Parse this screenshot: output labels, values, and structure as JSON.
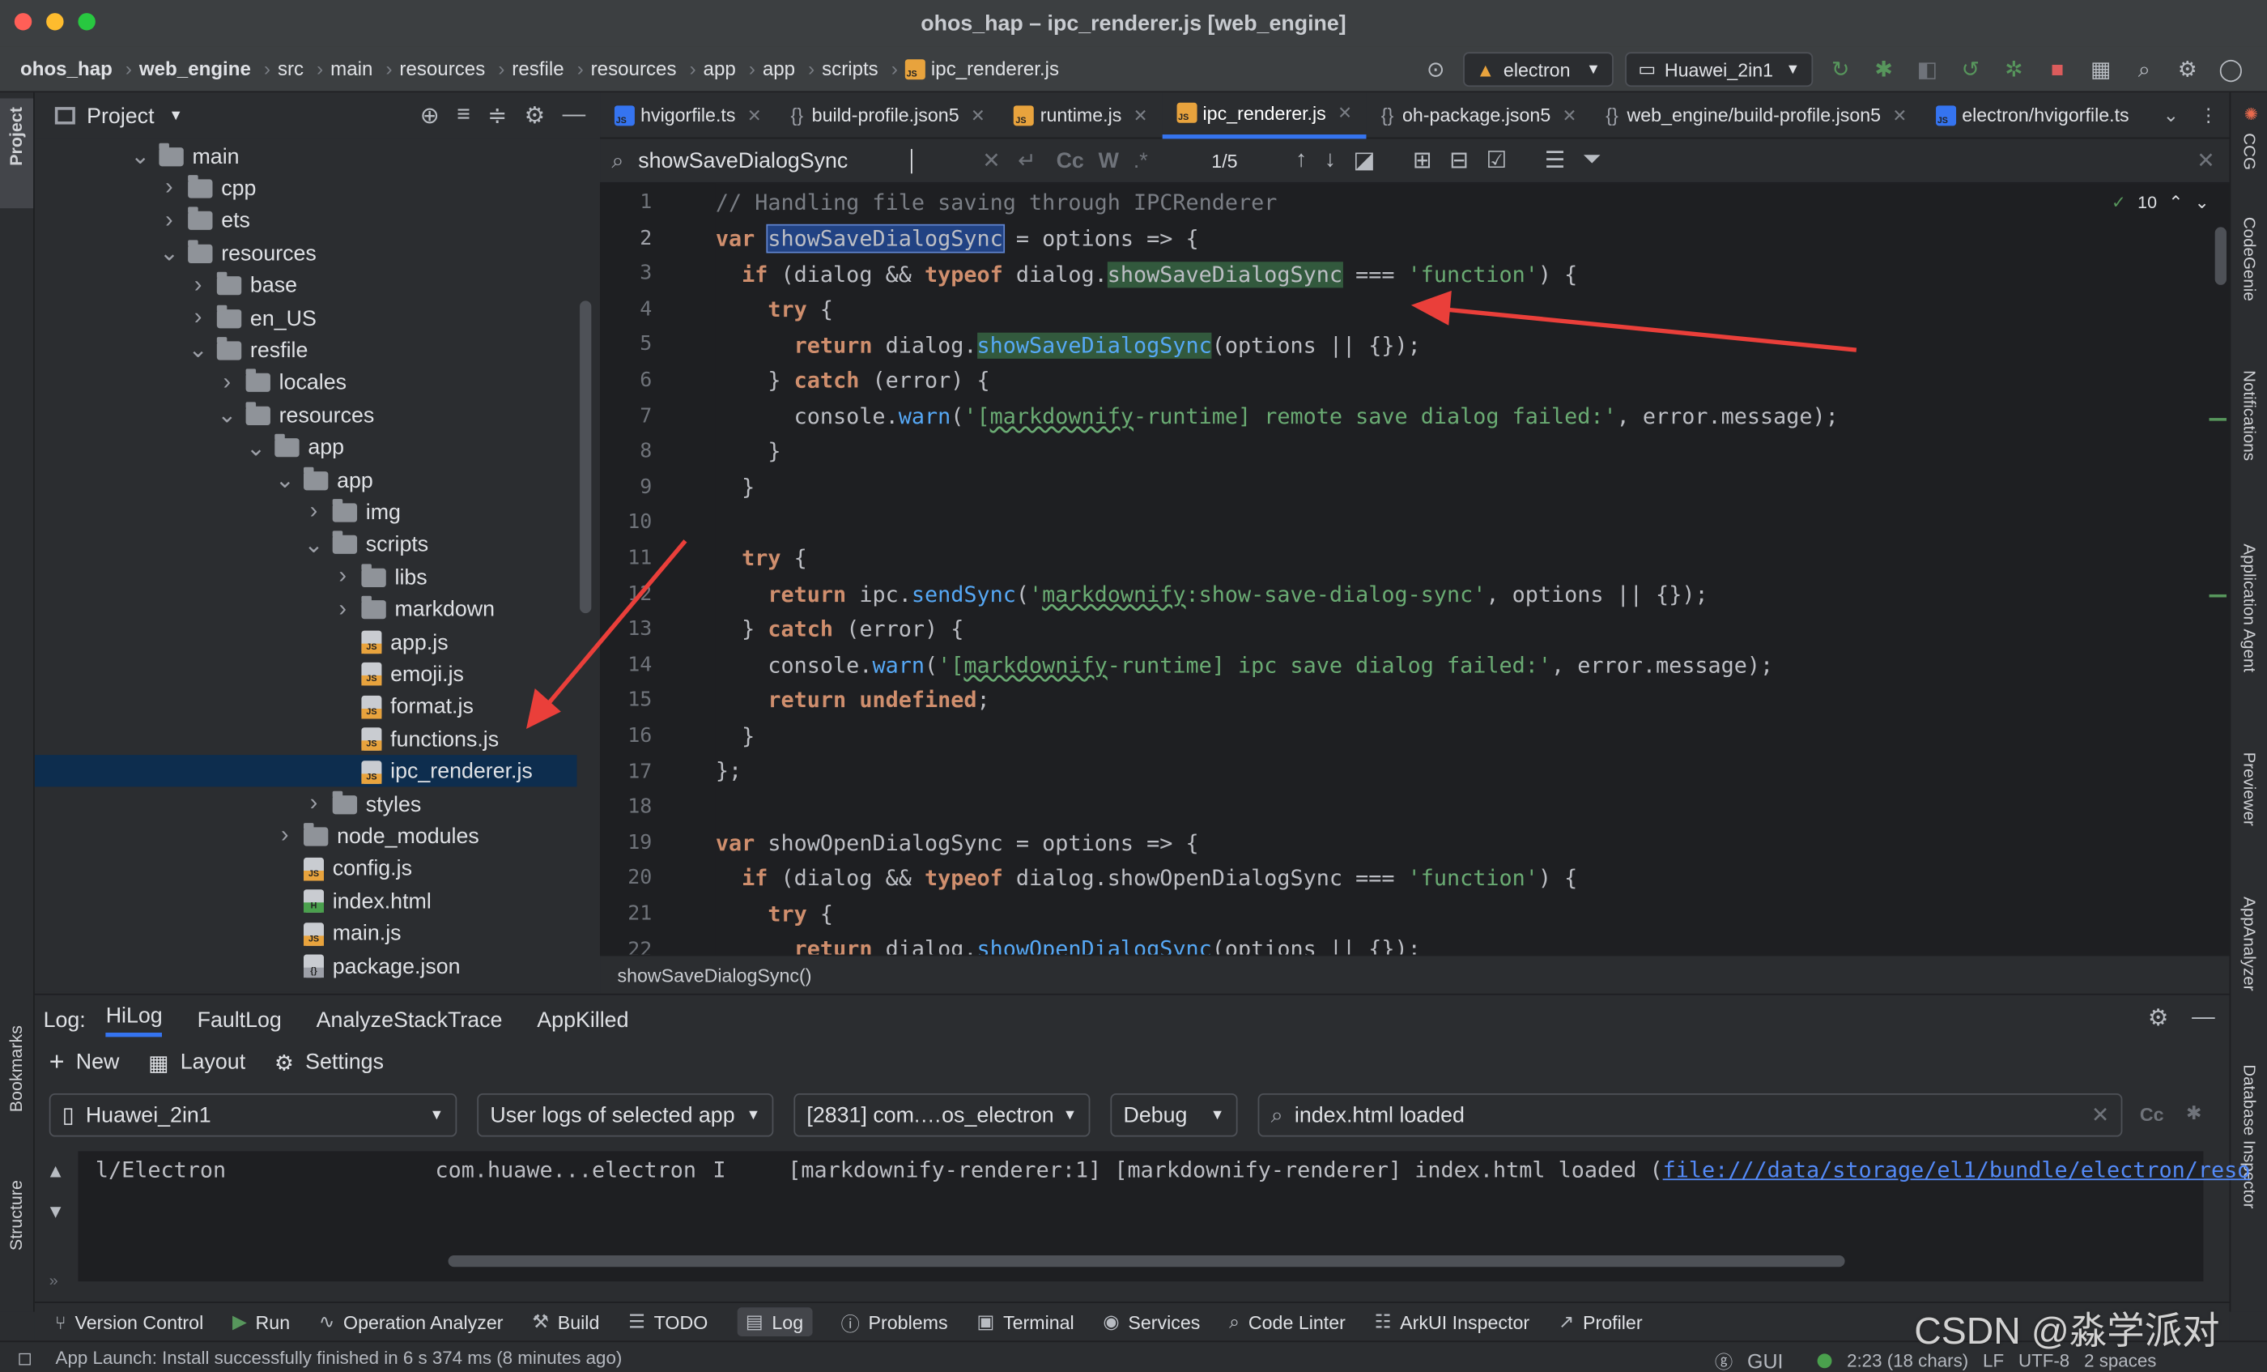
{
  "window": {
    "title": "ohos_hap – ipc_renderer.js [web_engine]"
  },
  "navbar": {
    "crumbs": [
      "ohos_hap",
      "web_engine",
      "src",
      "main",
      "resources",
      "resfile",
      "resources",
      "app",
      "app",
      "scripts",
      "ipc_renderer.js"
    ],
    "run_config": "electron",
    "device": "Huawei_2in1"
  },
  "project_panel": {
    "title": "Project",
    "tree": [
      {
        "label": "main",
        "type": "folder",
        "open": true
      },
      {
        "label": "cpp",
        "type": "folder"
      },
      {
        "label": "ets",
        "type": "folder"
      },
      {
        "label": "resources",
        "type": "folder",
        "open": true
      },
      {
        "label": "base",
        "type": "folder"
      },
      {
        "label": "en_US",
        "type": "folder"
      },
      {
        "label": "resfile",
        "type": "folder",
        "open": true
      },
      {
        "label": "locales",
        "type": "folder"
      },
      {
        "label": "resources",
        "type": "folder",
        "open": true
      },
      {
        "label": "app",
        "type": "folder",
        "open": true
      },
      {
        "label": "app",
        "type": "folder",
        "open": true
      },
      {
        "label": "img",
        "type": "folder"
      },
      {
        "label": "scripts",
        "type": "folder",
        "open": true
      },
      {
        "label": "libs",
        "type": "folder"
      },
      {
        "label": "markdown",
        "type": "folder"
      },
      {
        "label": "app.js",
        "type": "js"
      },
      {
        "label": "emoji.js",
        "type": "js"
      },
      {
        "label": "format.js",
        "type": "js"
      },
      {
        "label": "functions.js",
        "type": "js"
      },
      {
        "label": "ipc_renderer.js",
        "type": "js",
        "selected": true
      },
      {
        "label": "styles",
        "type": "folder"
      },
      {
        "label": "node_modules",
        "type": "folder"
      },
      {
        "label": "config.js",
        "type": "js"
      },
      {
        "label": "index.html",
        "type": "html"
      },
      {
        "label": "main.js",
        "type": "js"
      },
      {
        "label": "package.json",
        "type": "json"
      }
    ]
  },
  "tabs": [
    "hvigorfile.ts",
    "build-profile.json5",
    "runtime.js",
    "ipc_renderer.js",
    "oh-package.json5",
    "web_engine/build-profile.json5",
    "electron/hvigorfile.ts"
  ],
  "find": {
    "query": "showSaveDialogSync",
    "match_count": "1/5",
    "case_label": "Cc",
    "word_label": "W",
    "regex_label": ".*"
  },
  "editor": {
    "inspection_count": "10",
    "line_numbers": [
      "1",
      "2",
      "3",
      "4",
      "5",
      "6",
      "7",
      "8",
      "9",
      "10",
      "11",
      "12",
      "13",
      "14",
      "15",
      "16",
      "17",
      "18",
      "19",
      "20",
      "21",
      "22"
    ],
    "code_line_1": "// Handling file saving through IPCRenderer",
    "code_line_19": "showOpenDialogSync = options => {",
    "breadcrumb": "showSaveDialogSync()"
  },
  "log_panel": {
    "label": "Log:",
    "tabs": [
      "HiLog",
      "FaultLog",
      "AnalyzeStackTrace",
      "AppKilled"
    ],
    "actions": [
      "New",
      "Layout",
      "Settings"
    ],
    "device": "Huawei_2in1",
    "log_scope": "User logs of selected app",
    "process": "[2831] com.…os_electron",
    "level": "Debug",
    "filter": "index.html loaded",
    "line": {
      "tag": "l/Electron",
      "package": "com.huawe...electron",
      "level": "I",
      "message": "[markdownify-renderer:1] [markdownify-renderer] index.html loaded (",
      "link": "file:///data/storage/el1/bundle/electron/reso"
    }
  },
  "bottom_tools": [
    "Version Control",
    "Run",
    "Operation Analyzer",
    "Build",
    "TODO",
    "Log",
    "Problems",
    "Terminal",
    "Services",
    "Code Linter",
    "ArkUI Inspector",
    "Profiler"
  ],
  "left_strip": [
    "Project",
    "Bookmarks",
    "Structure"
  ],
  "right_strip": [
    "CCG",
    "CodeGenie",
    "Notifications",
    "Application Agent",
    "Previewer",
    "AppAnalyzer",
    "Database Inspector"
  ],
  "status": {
    "message": "App Launch: Install successfully finished in 6 s 374 ms (8 minutes ago)",
    "gui": "GUI",
    "position": "2:23 (18 chars)",
    "line_sep": "LF",
    "encoding": "UTF-8",
    "indent": "2 spaces"
  },
  "watermark": "CSDN @淼学派对"
}
